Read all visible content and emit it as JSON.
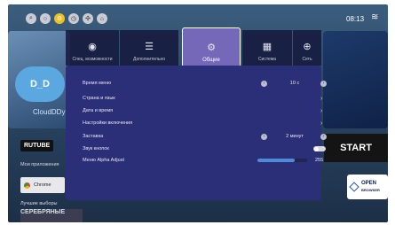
{
  "status": {
    "clock": "08:13"
  },
  "tabs": [
    {
      "label": "Спец. возможности",
      "icon": "accessibility-icon"
    },
    {
      "label": "Дополнительно",
      "icon": "sliders-icon"
    },
    {
      "label": "Общие",
      "icon": "gear-icon"
    },
    {
      "label": "Система",
      "icon": "grid-icon"
    },
    {
      "label": "Сеть",
      "icon": "globe-icon"
    }
  ],
  "settings": {
    "rows": [
      {
        "label": "Время меню",
        "value": "10 с"
      },
      {
        "label": "Страна и язык"
      },
      {
        "label": "Дата и время"
      },
      {
        "label": "Настройки включения"
      },
      {
        "label": "Заставка",
        "value": "2 минут"
      },
      {
        "label": "Звук кнопок"
      },
      {
        "label": "Меню Alpha Adjust",
        "value": "255"
      }
    ],
    "alpha_fill_fraction": 0.75
  },
  "background": {
    "cloud_title": "D_D",
    "cloud_caption": "CloudDDy",
    "rutube": "RUTUBE",
    "my_apps": "Мои приложения",
    "chrome": "Chrome",
    "best_picks": "Лучшие выборы",
    "poster": "СЕРЕБРЯНЫЕ",
    "start": "START",
    "open_browser_1": "OPEN",
    "open_browser_2": "BROWSER"
  },
  "colors": {
    "panel": "#2a2f78",
    "selected_tab": "#7568b8",
    "slider_fill": "#4f8ad8",
    "accent": "#f0c020"
  }
}
